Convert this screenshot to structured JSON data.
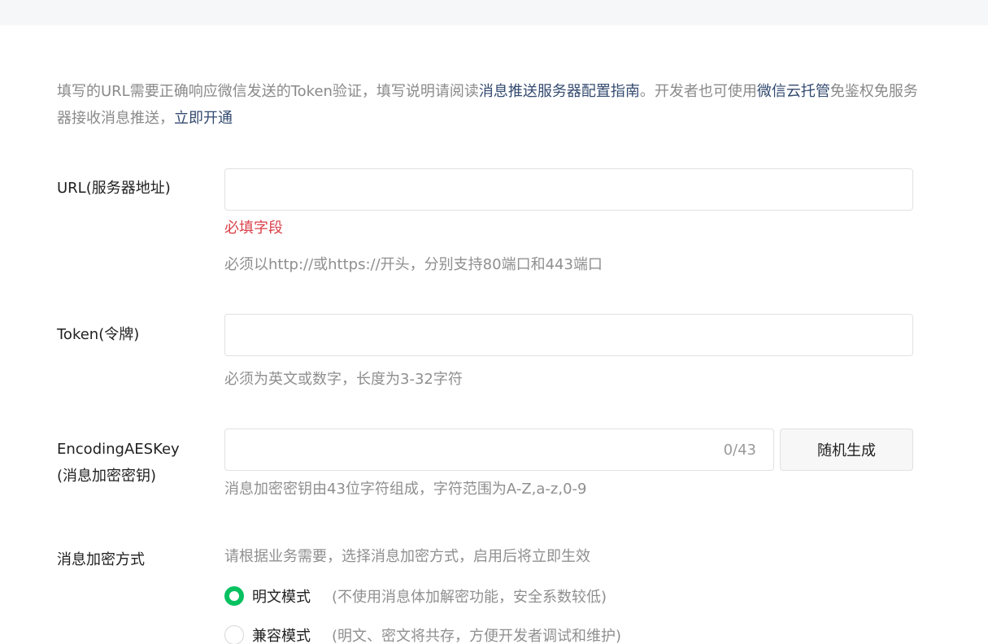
{
  "intro": {
    "text1": "填写的URL需要正确响应微信发送的Token验证，填写说明请阅读",
    "link1": "消息推送服务器配置指南",
    "text2": "。开发者也可使用",
    "link2": "微信云托管",
    "text3": "免鉴权免服务器接收消息推送，",
    "link3": "立即开通"
  },
  "url": {
    "label": "URL(服务器地址)",
    "value": "",
    "error": "必填字段",
    "help": "必须以http://或https://开头，分别支持80端口和443端口"
  },
  "token": {
    "label": "Token(令牌)",
    "value": "",
    "help": "必须为英文或数字，长度为3-32字符"
  },
  "aeskey": {
    "label_line1": "EncodingAESKey",
    "label_line2": "(消息加密密钥)",
    "value": "",
    "counter": "0/43",
    "button": "随机生成",
    "help": "消息加密密钥由43位字符组成，字符范围为A-Z,a-z,0-9"
  },
  "encryption": {
    "label": "消息加密方式",
    "help": "请根据业务需要，选择消息加密方式，启用后将立即生效",
    "options": [
      {
        "label": "明文模式",
        "desc": "(不使用消息体加解密功能，安全系数较低)",
        "selected": true
      },
      {
        "label": "兼容模式",
        "desc": "(明文、密文将共存，方便开发者调试和维护)",
        "selected": false
      }
    ]
  },
  "colors": {
    "accent": "#07c160",
    "link": "#344b70",
    "error": "#d9424a"
  }
}
